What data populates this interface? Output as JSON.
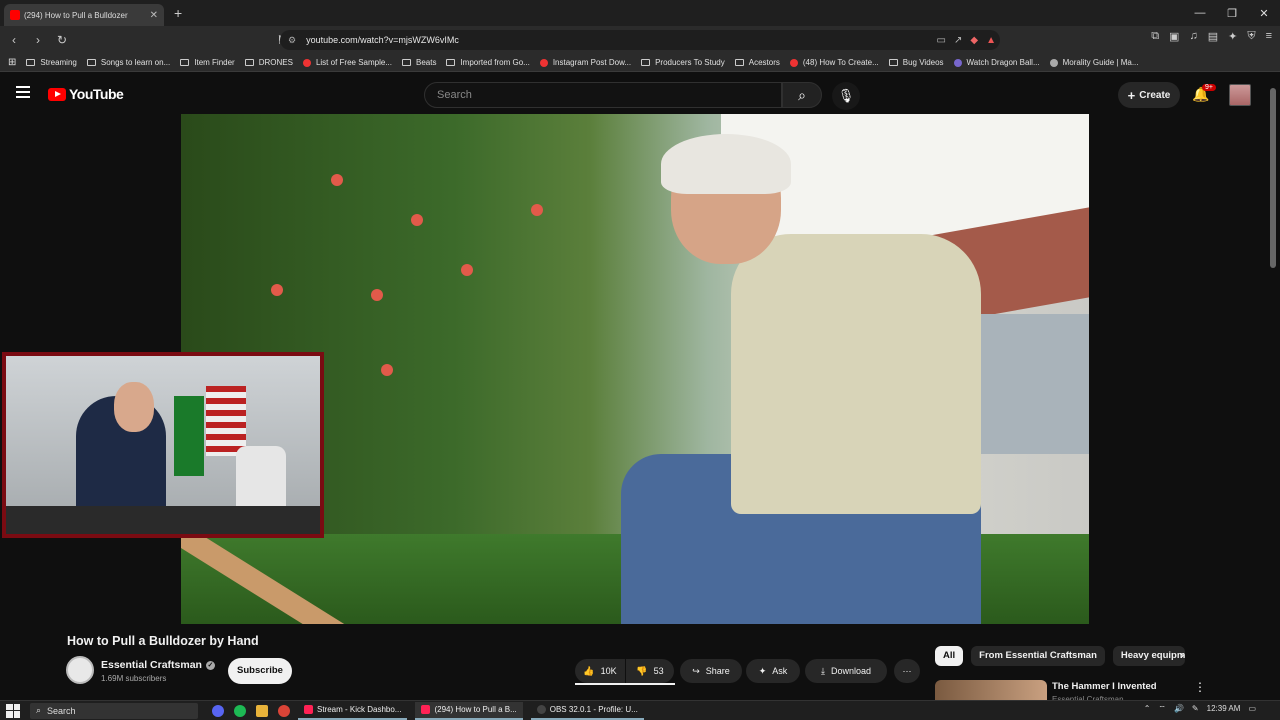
{
  "browser": {
    "tab_title": "(294) How to Pull a Bulldozer",
    "url": "youtube.com/watch?v=mjsWZW6vIMc",
    "bookmarks": [
      "Streaming",
      "Songs to learn on...",
      "Item Finder",
      "DRONES",
      "List of Free Sample...",
      "Beats",
      "Imported from Go...",
      "Instagram Post Dow...",
      "Producers To Study",
      "Acestors",
      "(48) How To Create...",
      "Bug Videos",
      "Watch Dragon Ball...",
      "Morality Guide | Ma..."
    ]
  },
  "youtube": {
    "logo_text": "YouTube",
    "search_placeholder": "Search",
    "create_label": "Create",
    "notifications_badge": "9+"
  },
  "video": {
    "title": "How to Pull a Bulldozer by Hand",
    "channel": "Essential Craftsman",
    "subscribers": "1.69M subscribers",
    "subscribe_label": "Subscribe",
    "likes": "10K",
    "dislikes": "53",
    "share_label": "Share",
    "ask_label": "Ask",
    "download_label": "Download"
  },
  "chips": [
    "All",
    "From Essential Craftsman",
    "Heavy equipm"
  ],
  "related": {
    "title": "The Hammer I Invented",
    "channel": "Essential Craftsman"
  },
  "taskbar": {
    "search_label": "Search",
    "apps": [
      "Stream - Kick Dashbo...",
      "(294) How to Pull a B...",
      "OBS 32.0.1 - Profile: U..."
    ],
    "time": "12:39 AM"
  },
  "colors": {
    "accent": "#ff0000",
    "webcam_border": "#7a0b12",
    "background": "#0f0f0f"
  }
}
